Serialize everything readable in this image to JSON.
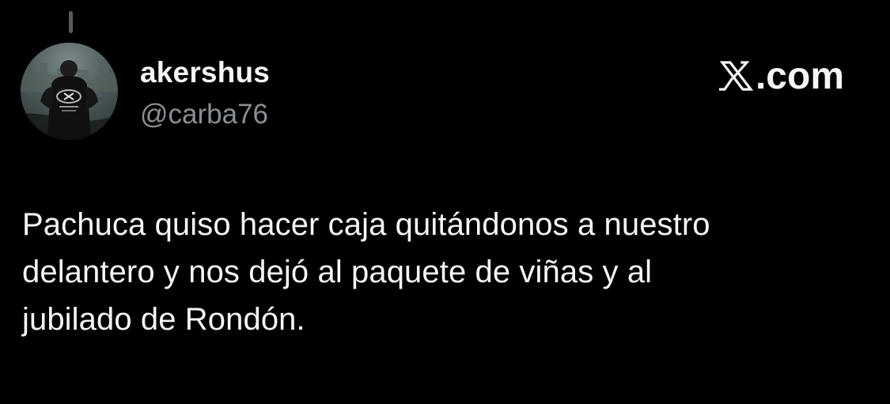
{
  "tweet": {
    "author": {
      "display_name": "akershus",
      "handle": "@carba76",
      "avatar_icon": "user-avatar-icon"
    },
    "brand": {
      "label": ".com",
      "icon": "x-logo-icon"
    },
    "text_lines": [
      "Pachuca quiso hacer caja quitándonos a nuestro",
      "delantero y nos dejó al paquete de viñas y al",
      "jubilado de Rondón."
    ]
  },
  "colors": {
    "background": "#000000",
    "primary_text": "#f5f5f5",
    "secondary_text": "#8b8f93",
    "thread_line": "#5a5a5a"
  }
}
